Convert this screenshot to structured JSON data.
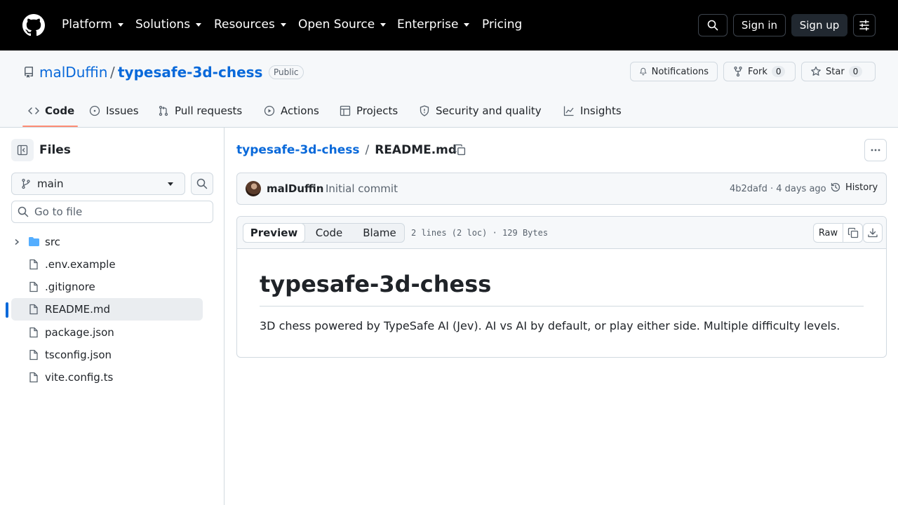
{
  "header": {
    "nav": [
      {
        "label": "Platform",
        "dropdown": true
      },
      {
        "label": "Solutions",
        "dropdown": true
      },
      {
        "label": "Resources",
        "dropdown": true
      },
      {
        "label": "Open Source",
        "dropdown": true
      },
      {
        "label": "Enterprise",
        "dropdown": true
      },
      {
        "label": "Pricing",
        "dropdown": false
      }
    ],
    "sign_in": "Sign in",
    "sign_up": "Sign up"
  },
  "repo": {
    "owner": "malDuffin",
    "separator": "/",
    "name": "typesafe-3d-chess",
    "visibility": "Public",
    "notifications_label": "Notifications",
    "fork_label": "Fork",
    "fork_count": "0",
    "star_label": "Star",
    "star_count": "0"
  },
  "tabs": [
    {
      "label": "Code",
      "icon": "code-icon",
      "selected": true
    },
    {
      "label": "Issues",
      "icon": "issue-icon"
    },
    {
      "label": "Pull requests",
      "icon": "pull-request-icon"
    },
    {
      "label": "Actions",
      "icon": "play-icon"
    },
    {
      "label": "Projects",
      "icon": "table-icon"
    },
    {
      "label": "Security and quality",
      "icon": "shield-icon"
    },
    {
      "label": "Insights",
      "icon": "graph-icon"
    }
  ],
  "sidebar": {
    "title": "Files",
    "branch": "main",
    "goto_placeholder": "Go to file",
    "tree": [
      {
        "name": "src",
        "type": "folder",
        "selected": false
      },
      {
        "name": ".env.example",
        "type": "file",
        "selected": false
      },
      {
        "name": ".gitignore",
        "type": "file",
        "selected": false
      },
      {
        "name": "README.md",
        "type": "file",
        "selected": true
      },
      {
        "name": "package.json",
        "type": "file",
        "selected": false
      },
      {
        "name": "tsconfig.json",
        "type": "file",
        "selected": false
      },
      {
        "name": "vite.config.ts",
        "type": "file",
        "selected": false
      }
    ]
  },
  "main": {
    "breadcrumb_repo": "typesafe-3d-chess",
    "breadcrumb_sep": "/",
    "breadcrumb_file": "README.md",
    "commit": {
      "author": "malDuffin",
      "message": "Initial commit",
      "meta": "4b2dafd · 4 days ago",
      "history": "History"
    },
    "view_tabs": [
      "Preview",
      "Code",
      "Blame"
    ],
    "file_info": "2 lines (2 loc) · 129 Bytes",
    "raw_label": "Raw",
    "readme": {
      "heading": "typesafe-3d-chess",
      "paragraph": "3D chess powered by TypeSafe AI (Jev). AI vs AI by default, or play either side. Multiple difficulty levels."
    }
  },
  "colors": {
    "accent": "#0969da",
    "tab_underline": "#fd8c73",
    "header_bg": "#000000"
  }
}
